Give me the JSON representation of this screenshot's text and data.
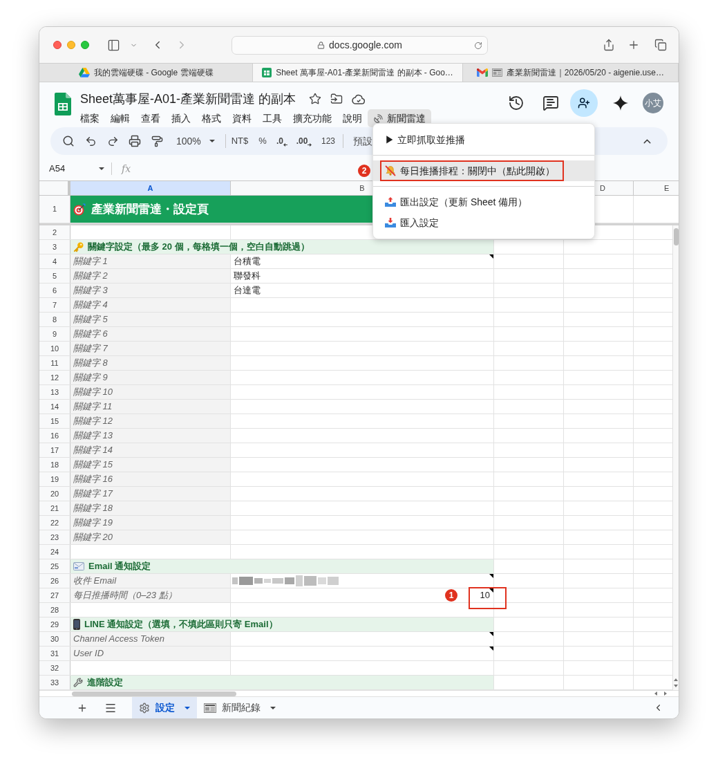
{
  "browser": {
    "url": "docs.google.com",
    "tabs": [
      {
        "title": "我的雲端硬碟 - Google 雲端硬碟",
        "selected": false
      },
      {
        "title": "Sheet 萬事屋-A01-產業新聞雷達 的副本 - Goo…",
        "selected": true
      },
      {
        "title": "產業新聞雷達｜2026/05/20 - aigenie.use…",
        "selected": false
      }
    ]
  },
  "document": {
    "title": "Sheet萬事屋-A01-產業新聞雷達 的副本",
    "menu": [
      {
        "label": "檔案",
        "kind": "menu",
        "selected": false
      },
      {
        "label": "編輯",
        "kind": "menu",
        "selected": false
      },
      {
        "label": "查看",
        "kind": "menu",
        "selected": false
      },
      {
        "label": "插入",
        "kind": "menu",
        "selected": false
      },
      {
        "label": "格式",
        "kind": "menu",
        "selected": false
      },
      {
        "label": "資料",
        "kind": "menu",
        "selected": false
      },
      {
        "label": "工具",
        "kind": "menu",
        "selected": false
      },
      {
        "label": "擴充功能",
        "kind": "menu",
        "selected": false
      },
      {
        "label": "說明",
        "kind": "menu",
        "selected": false
      },
      {
        "label": "新聞雷達",
        "kind": "addon",
        "selected": true
      }
    ],
    "avatar": "小艾"
  },
  "toolbar": {
    "zoom": "100%",
    "currency": "NT$",
    "percent": "%",
    "fewer_decimals": ".0",
    "more_decimals": ".00",
    "number_format": "123",
    "font": "預設"
  },
  "dropdown": {
    "groups": [
      {
        "items": [
          {
            "kind": "action",
            "label": "▶ 立即抓取並推播",
            "selected": false
          }
        ]
      },
      {
        "items": [
          {
            "kind": "schedule_off",
            "label": "每日推播排程：關閉中（點此開啟）",
            "selected": true,
            "callout": "2"
          }
        ]
      },
      {
        "items": [
          {
            "kind": "export",
            "label": "匯出設定（更新 Sheet 備用）",
            "selected": false
          },
          {
            "kind": "import",
            "label": "匯入設定",
            "selected": false
          }
        ]
      }
    ]
  },
  "formula_bar": {
    "name_box": "A54",
    "function_label": "fx"
  },
  "grid": {
    "columns": [
      {
        "label": "A",
        "selected": true
      },
      {
        "label": "B",
        "selected": false
      },
      {
        "label": "D",
        "selected": false
      },
      {
        "label": "E",
        "selected": false
      }
    ],
    "rows": [
      {
        "number": "1",
        "kind": "title",
        "text": "產業新聞雷達・設定頁"
      },
      {
        "number": "2",
        "kind": "blank"
      },
      {
        "number": "3",
        "kind": "section",
        "text": "關鍵字設定（最多 20 個，每格填一個，空白自動跳過）"
      },
      {
        "number": "4",
        "kind": "field",
        "label": "關鍵字 1",
        "value": {
          "kind": "text",
          "text": "台積電"
        },
        "note": true
      },
      {
        "number": "5",
        "kind": "field",
        "label": "關鍵字 2",
        "value": {
          "kind": "text",
          "text": "聯發科"
        },
        "note": false
      },
      {
        "number": "6",
        "kind": "field",
        "label": "關鍵字 3",
        "value": {
          "kind": "text",
          "text": "台達電"
        },
        "note": false
      },
      {
        "number": "7",
        "kind": "field",
        "label": "關鍵字 4",
        "note": false
      },
      {
        "number": "8",
        "kind": "field",
        "label": "關鍵字 5",
        "note": false
      },
      {
        "number": "9",
        "kind": "field",
        "label": "關鍵字 6",
        "note": false
      },
      {
        "number": "10",
        "kind": "field",
        "label": "關鍵字 7",
        "note": false
      },
      {
        "number": "11",
        "kind": "field",
        "label": "關鍵字 8",
        "note": false
      },
      {
        "number": "12",
        "kind": "field",
        "label": "關鍵字 9",
        "note": false
      },
      {
        "number": "13",
        "kind": "field",
        "label": "關鍵字 10",
        "note": false
      },
      {
        "number": "14",
        "kind": "field",
        "label": "關鍵字 11",
        "note": false
      },
      {
        "number": "15",
        "kind": "field",
        "label": "關鍵字 12",
        "note": false
      },
      {
        "number": "16",
        "kind": "field",
        "label": "關鍵字 13",
        "note": false
      },
      {
        "number": "17",
        "kind": "field",
        "label": "關鍵字 14",
        "note": false
      },
      {
        "number": "18",
        "kind": "field",
        "label": "關鍵字 15",
        "note": false
      },
      {
        "number": "19",
        "kind": "field",
        "label": "關鍵字 16",
        "note": false
      },
      {
        "number": "20",
        "kind": "field",
        "label": "關鍵字 17",
        "note": false
      },
      {
        "number": "21",
        "kind": "field",
        "label": "關鍵字 18",
        "note": false
      },
      {
        "number": "22",
        "kind": "field",
        "label": "關鍵字 19",
        "note": false
      },
      {
        "number": "23",
        "kind": "field",
        "label": "關鍵字 20",
        "note": false
      },
      {
        "number": "24",
        "kind": "blank"
      },
      {
        "number": "25",
        "kind": "section",
        "text": "Email 通知設定"
      },
      {
        "number": "26",
        "kind": "field",
        "label": "收件 Email",
        "value": {
          "kind": "masked"
        },
        "note": true
      },
      {
        "number": "27",
        "kind": "field",
        "label": "每日推播時間（0–23 點）",
        "value": {
          "kind": "number",
          "text": "10"
        },
        "note": true,
        "callout": "1"
      },
      {
        "number": "28",
        "kind": "blank"
      },
      {
        "number": "29",
        "kind": "section",
        "text": "LINE 通知設定（選填，不填此區則只寄 Email）"
      },
      {
        "number": "30",
        "kind": "field",
        "label": "Channel Access Token",
        "note": true
      },
      {
        "number": "31",
        "kind": "field",
        "label": "User ID",
        "note": true
      },
      {
        "number": "32",
        "kind": "blank"
      },
      {
        "number": "33",
        "kind": "section",
        "text": "進階設定"
      }
    ]
  },
  "sheet_tabs": [
    {
      "label": "設定",
      "selected": true
    },
    {
      "label": "新聞紀錄",
      "selected": false
    }
  ]
}
